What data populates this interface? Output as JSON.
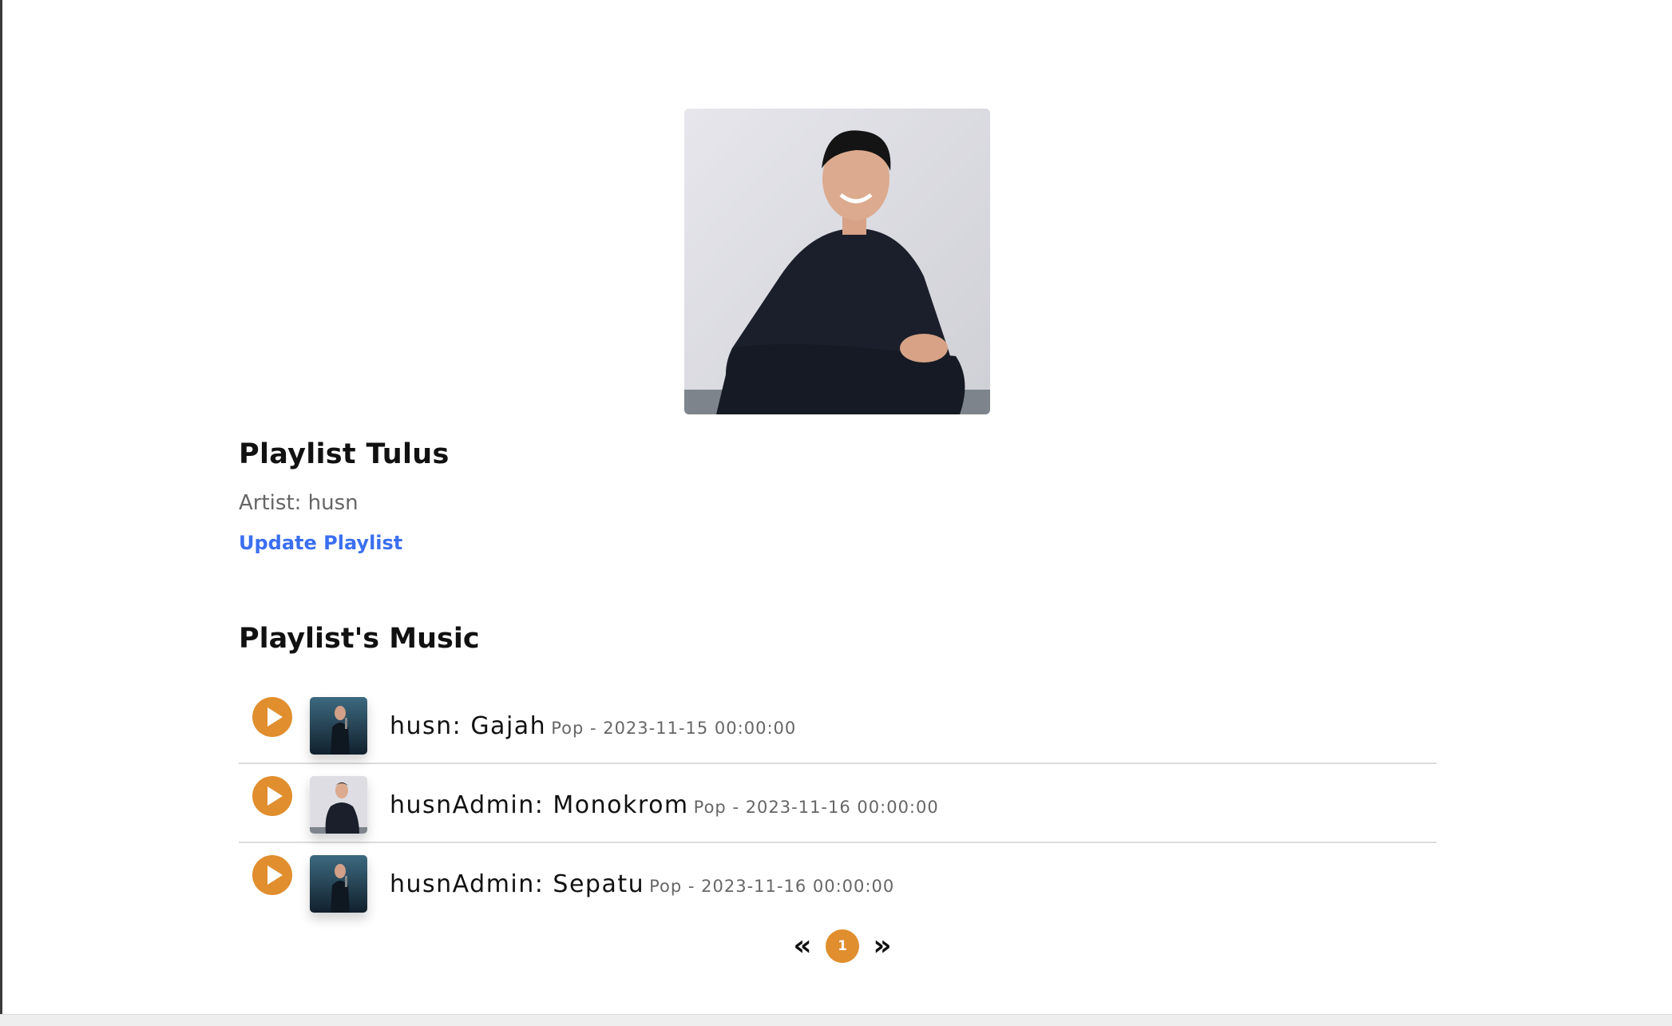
{
  "playlist": {
    "title": "Playlist Tulus",
    "artist_line": "Artist: husn",
    "update_label": "Update Playlist"
  },
  "music_section": {
    "title": "Playlist's Music",
    "songs": [
      {
        "title": "husn: Gajah",
        "meta": "Pop - 2023-11-15 00:00:00",
        "thumb": "stage-photo"
      },
      {
        "title": "husnAdmin: Monokrom",
        "meta": "Pop - 2023-11-16 00:00:00",
        "thumb": "seated-photo"
      },
      {
        "title": "husnAdmin: Sepatu",
        "meta": "Pop - 2023-11-16 00:00:00",
        "thumb": "stage-photo"
      }
    ]
  },
  "pagination": {
    "prev_icon": "«",
    "current": "1",
    "next_icon": "»"
  },
  "colors": {
    "accent": "#e08e2e",
    "link": "#3b6ff0"
  }
}
